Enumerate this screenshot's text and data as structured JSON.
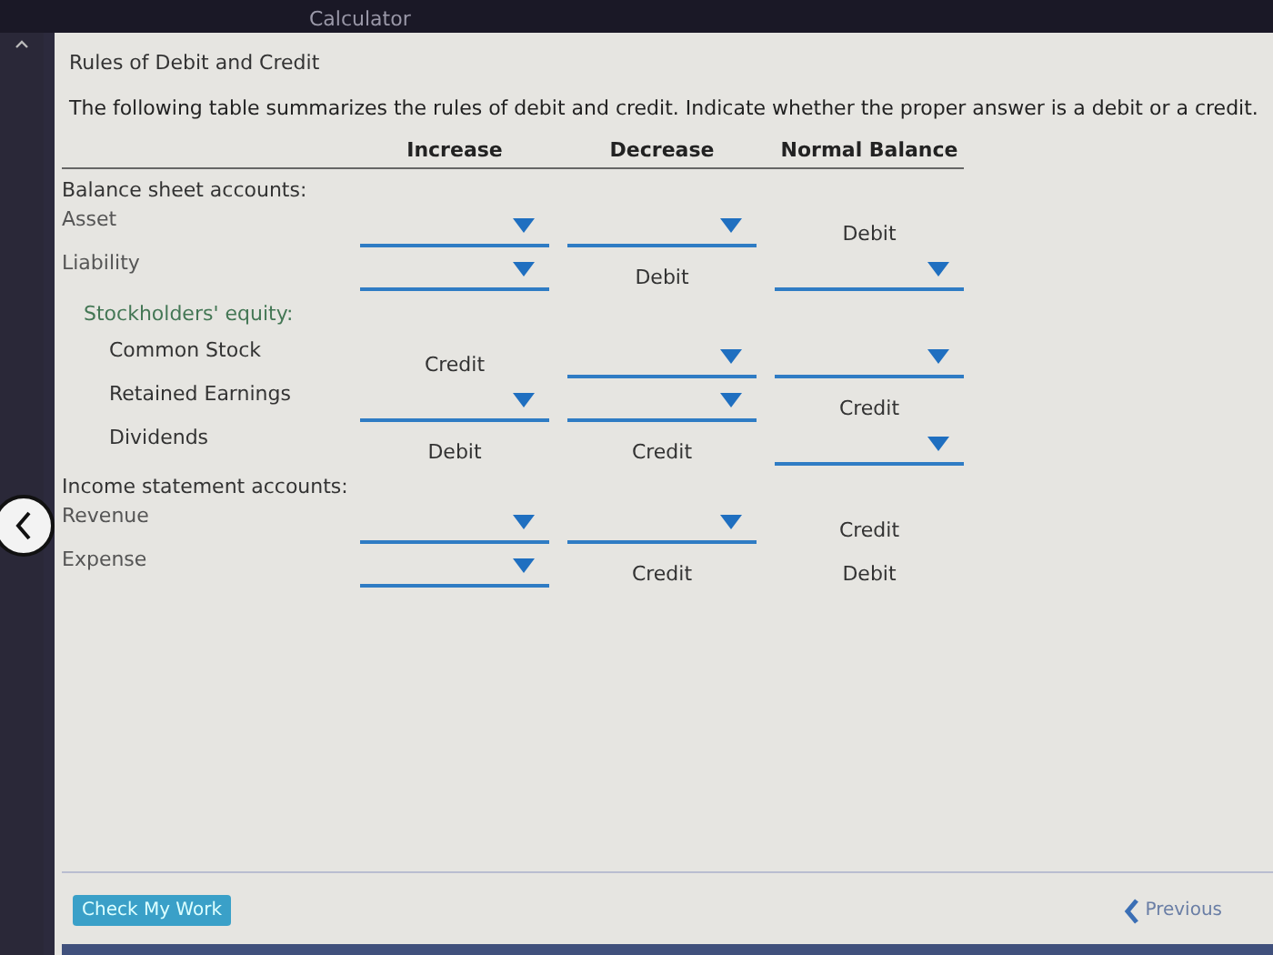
{
  "top_bar": {
    "tab": "Calculator"
  },
  "title": "Rules of Debit and Credit",
  "instructions": "The following table summarizes the rules of debit and credit. Indicate whether the proper answer is a debit or a credit.",
  "columns": [
    "Increase",
    "Decrease",
    "Normal Balance"
  ],
  "sections": [
    {
      "title": "Balance sheet accounts:",
      "rows": [
        {
          "name": "Asset",
          "cells": [
            {
              "kind": "select"
            },
            {
              "kind": "select"
            },
            {
              "kind": "text",
              "text": "Debit"
            }
          ]
        },
        {
          "name": "Liability",
          "cells": [
            {
              "kind": "select"
            },
            {
              "kind": "text",
              "text": "Debit"
            },
            {
              "kind": "select"
            }
          ]
        },
        {
          "name": "Stockholders' equity:",
          "children": [
            {
              "name": "Common Stock",
              "cells": [
                {
                  "kind": "text",
                  "text": "Credit"
                },
                {
                  "kind": "select"
                },
                {
                  "kind": "select"
                }
              ]
            },
            {
              "name": "Retained Earnings",
              "cells": [
                {
                  "kind": "select"
                },
                {
                  "kind": "select"
                },
                {
                  "kind": "text",
                  "text": "Credit"
                }
              ]
            },
            {
              "name": "Dividends",
              "cells": [
                {
                  "kind": "text",
                  "text": "Debit"
                },
                {
                  "kind": "text",
                  "text": "Credit"
                },
                {
                  "kind": "select"
                }
              ]
            }
          ]
        }
      ]
    },
    {
      "title": "Income statement accounts:",
      "rows": [
        {
          "name": "Revenue",
          "cells": [
            {
              "kind": "select"
            },
            {
              "kind": "select"
            },
            {
              "kind": "text",
              "text": "Credit"
            }
          ]
        },
        {
          "name": "Expense",
          "cells": [
            {
              "kind": "select"
            },
            {
              "kind": "text",
              "text": "Credit"
            },
            {
              "kind": "text",
              "text": "Debit"
            }
          ]
        }
      ]
    }
  ],
  "buttons": {
    "check": "Check My Work",
    "previous": "Previous"
  }
}
